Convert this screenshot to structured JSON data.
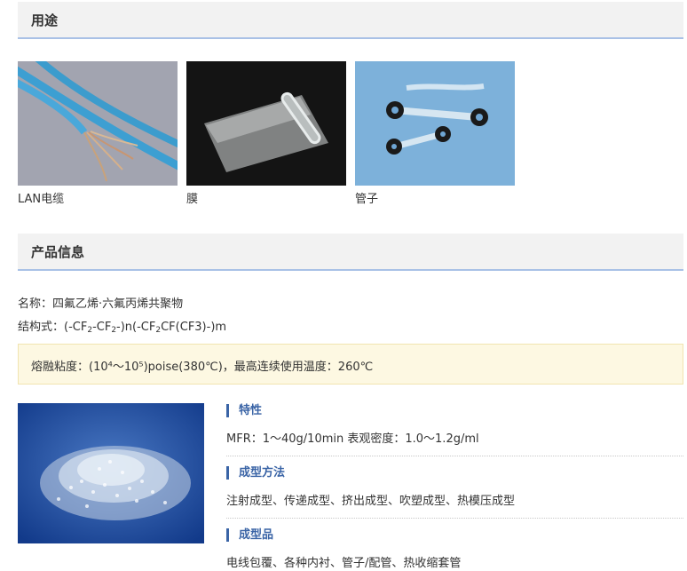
{
  "uses": {
    "title": "用途",
    "items": [
      {
        "caption": "LAN电缆",
        "icon": "lan-cable-image"
      },
      {
        "caption": "膜",
        "icon": "film-image"
      },
      {
        "caption": "管子",
        "icon": "tube-image"
      }
    ]
  },
  "product": {
    "title": "产品信息",
    "name_line": "名称：四氟乙烯·六氟丙烯共聚物",
    "formula": {
      "prefix": "结构式：(-CF",
      "sub1": "2",
      "mid1": "-CF",
      "sub2": "2",
      "mid2": "-)n(-CF",
      "sub3": "2",
      "suffix": "CF(CF3)-)m"
    },
    "notice": "熔融粘度：(10⁴～10⁵)poise(380℃)，最高连续使用温度：260℃",
    "image_icon": "pellets-image",
    "properties": [
      {
        "title": "特性",
        "text": "MFR：1～40g/10min 表观密度：1.0～1.2g/ml"
      },
      {
        "title": "成型方法",
        "text": "注射成型、传递成型、挤出成型、吹塑成型、热模压成型"
      },
      {
        "title": "成型品",
        "text": "电线包覆、各种内衬、管子/配管、热收缩套管"
      }
    ]
  },
  "colors": {
    "accent": "#3a64a6",
    "header_bg": "#f2f2f2",
    "header_rule": "#a9c1e6",
    "notice_bg": "#fdf8e2"
  }
}
